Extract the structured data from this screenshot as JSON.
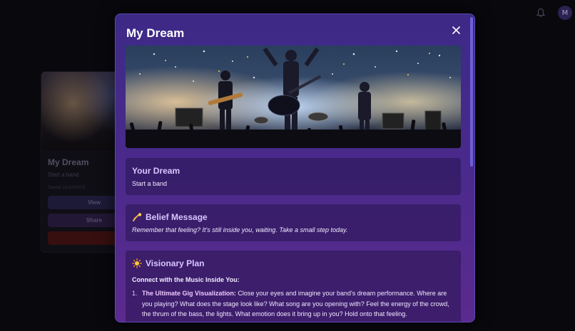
{
  "topbar": {
    "avatar_initial": "M"
  },
  "background_card": {
    "title": "My Dream",
    "subtitle": "Start a band",
    "saved": "Saved 11/10/2023",
    "view_label": "View",
    "share_label": "Share",
    "delete_label": ""
  },
  "modal": {
    "title": "My Dream",
    "close_icon": "close-icon",
    "dream": {
      "title": "Your Dream",
      "text": "Start a band"
    },
    "belief": {
      "icon": "shooting-star-icon",
      "title": "Belief Message",
      "text": "Remember that feeling? It's still inside you, waiting. Take a small step today."
    },
    "plan": {
      "icon": "sun-icon",
      "title": "Visionary Plan",
      "subtitle": "Connect with the Music Inside You:",
      "items": [
        {
          "number": "1.",
          "heading": "The Ultimate Gig Visualization:",
          "text": "Close your eyes and imagine your band's dream performance. Where are you playing? What does the stage look like? What song are you opening with? Feel the energy of the crowd, the thrum of the bass, the lights. What emotion does it bring up in you? Hold onto that feeling."
        }
      ]
    }
  },
  "colors": {
    "modal_top": "#3d2a86",
    "modal_bottom": "#5b2a8e",
    "accent": "#d9c6ff"
  }
}
